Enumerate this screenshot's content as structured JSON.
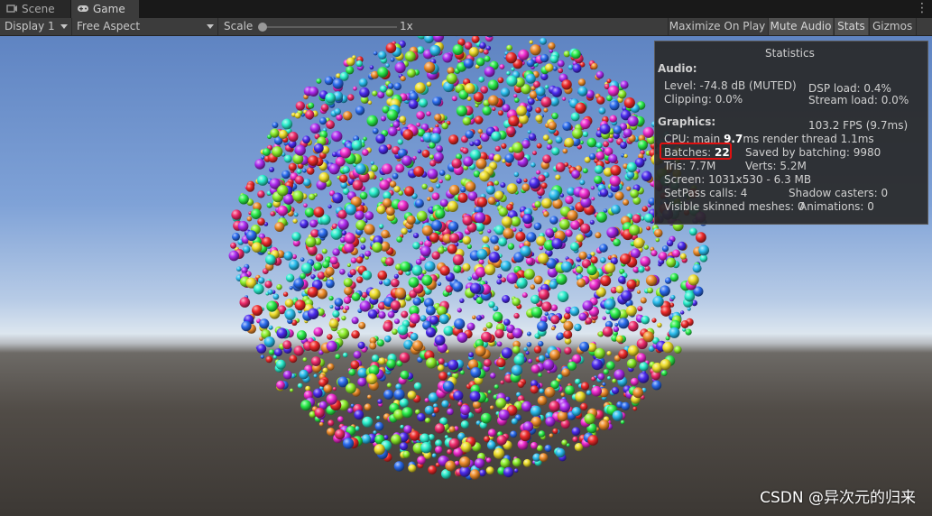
{
  "tabs": [
    {
      "label": "Scene",
      "icon": "scene-icon"
    },
    {
      "label": "Game",
      "icon": "gamepad-icon"
    }
  ],
  "toolbar": {
    "display": "Display 1",
    "aspect": "Free Aspect",
    "scale_label": "Scale",
    "scale_value": "1x",
    "maximize": "Maximize On Play",
    "mute": "Mute Audio",
    "stats": "Stats",
    "gizmos": "Gizmos"
  },
  "stats": {
    "title": "Statistics",
    "audio_heading": "Audio:",
    "level": "Level: -74.8 dB (MUTED)",
    "dsp": "DSP load: 0.4%",
    "clipping": "Clipping: 0.0%",
    "stream": "Stream load: 0.0%",
    "graphics_heading": "Graphics:",
    "fps": "103.2 FPS (9.7ms)",
    "cpu_prefix": "CPU: main ",
    "cpu_main": "9.7",
    "cpu_suffix": "ms  render thread 1.1ms",
    "batches_label": "Batches: ",
    "batches_value": "22",
    "saved": "Saved by batching: 9980",
    "tris": "Tris: 7.7M",
    "verts": "Verts: 5.2M",
    "screen": "Screen: 1031x530 - 6.3 MB",
    "setpass": "SetPass calls: 4",
    "shadow": "Shadow casters: 0",
    "skinned": "Visible skinned meshes: 0",
    "animations": "Animations: 0"
  },
  "watermark": "CSDN @异次元的归来",
  "colors": {
    "highlight": "#e01010",
    "sky": "#7fa2d7",
    "ground": "#514c47"
  }
}
